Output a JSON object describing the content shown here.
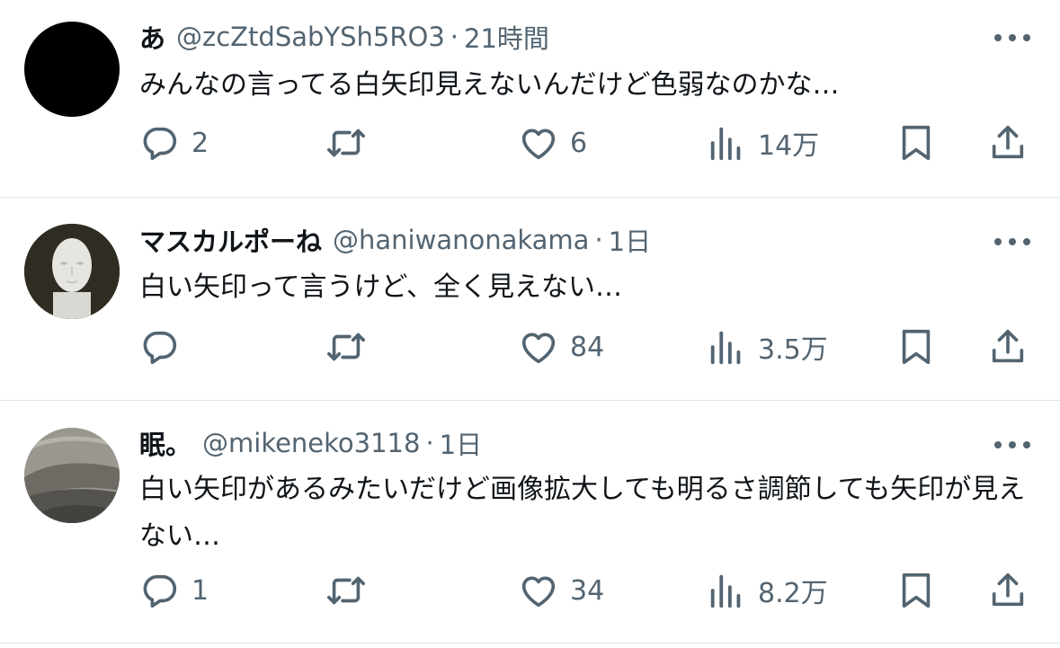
{
  "tweets": [
    {
      "name": "あ",
      "handle": "@zcZtdSabYSh5RO3",
      "separator": "·",
      "time": "21時間",
      "text": "みんなの言ってる白矢印見えないんだけど色弱なのかな…",
      "replies": "2",
      "retweets": "",
      "likes": "6",
      "views": "14万",
      "avatar": "black-circle"
    },
    {
      "name": "マスカルポーね",
      "handle": "@haniwanonakama",
      "separator": "·",
      "time": "1日",
      "text": "白い矢印って言うけど、全く見えない…",
      "replies": "",
      "retweets": "",
      "likes": "84",
      "views": "3.5万",
      "avatar": "mannequin-head"
    },
    {
      "name": "眠。",
      "handle": "@mikeneko3118",
      "separator": "·",
      "time": "1日",
      "text": "白い矢印があるみたいだけど画像拡大しても明るさ調節しても矢印が見えない…",
      "replies": "1",
      "retweets": "",
      "likes": "34",
      "views": "8.2万",
      "avatar": "spiral-staircase"
    }
  ],
  "icons": [
    "reply-icon",
    "retweet-icon",
    "like-icon",
    "views-icon",
    "bookmark-icon",
    "share-icon",
    "more-icon"
  ],
  "colors": {
    "text": "#0f1419",
    "secondary": "#536471",
    "divider": "#e1e8ed"
  }
}
